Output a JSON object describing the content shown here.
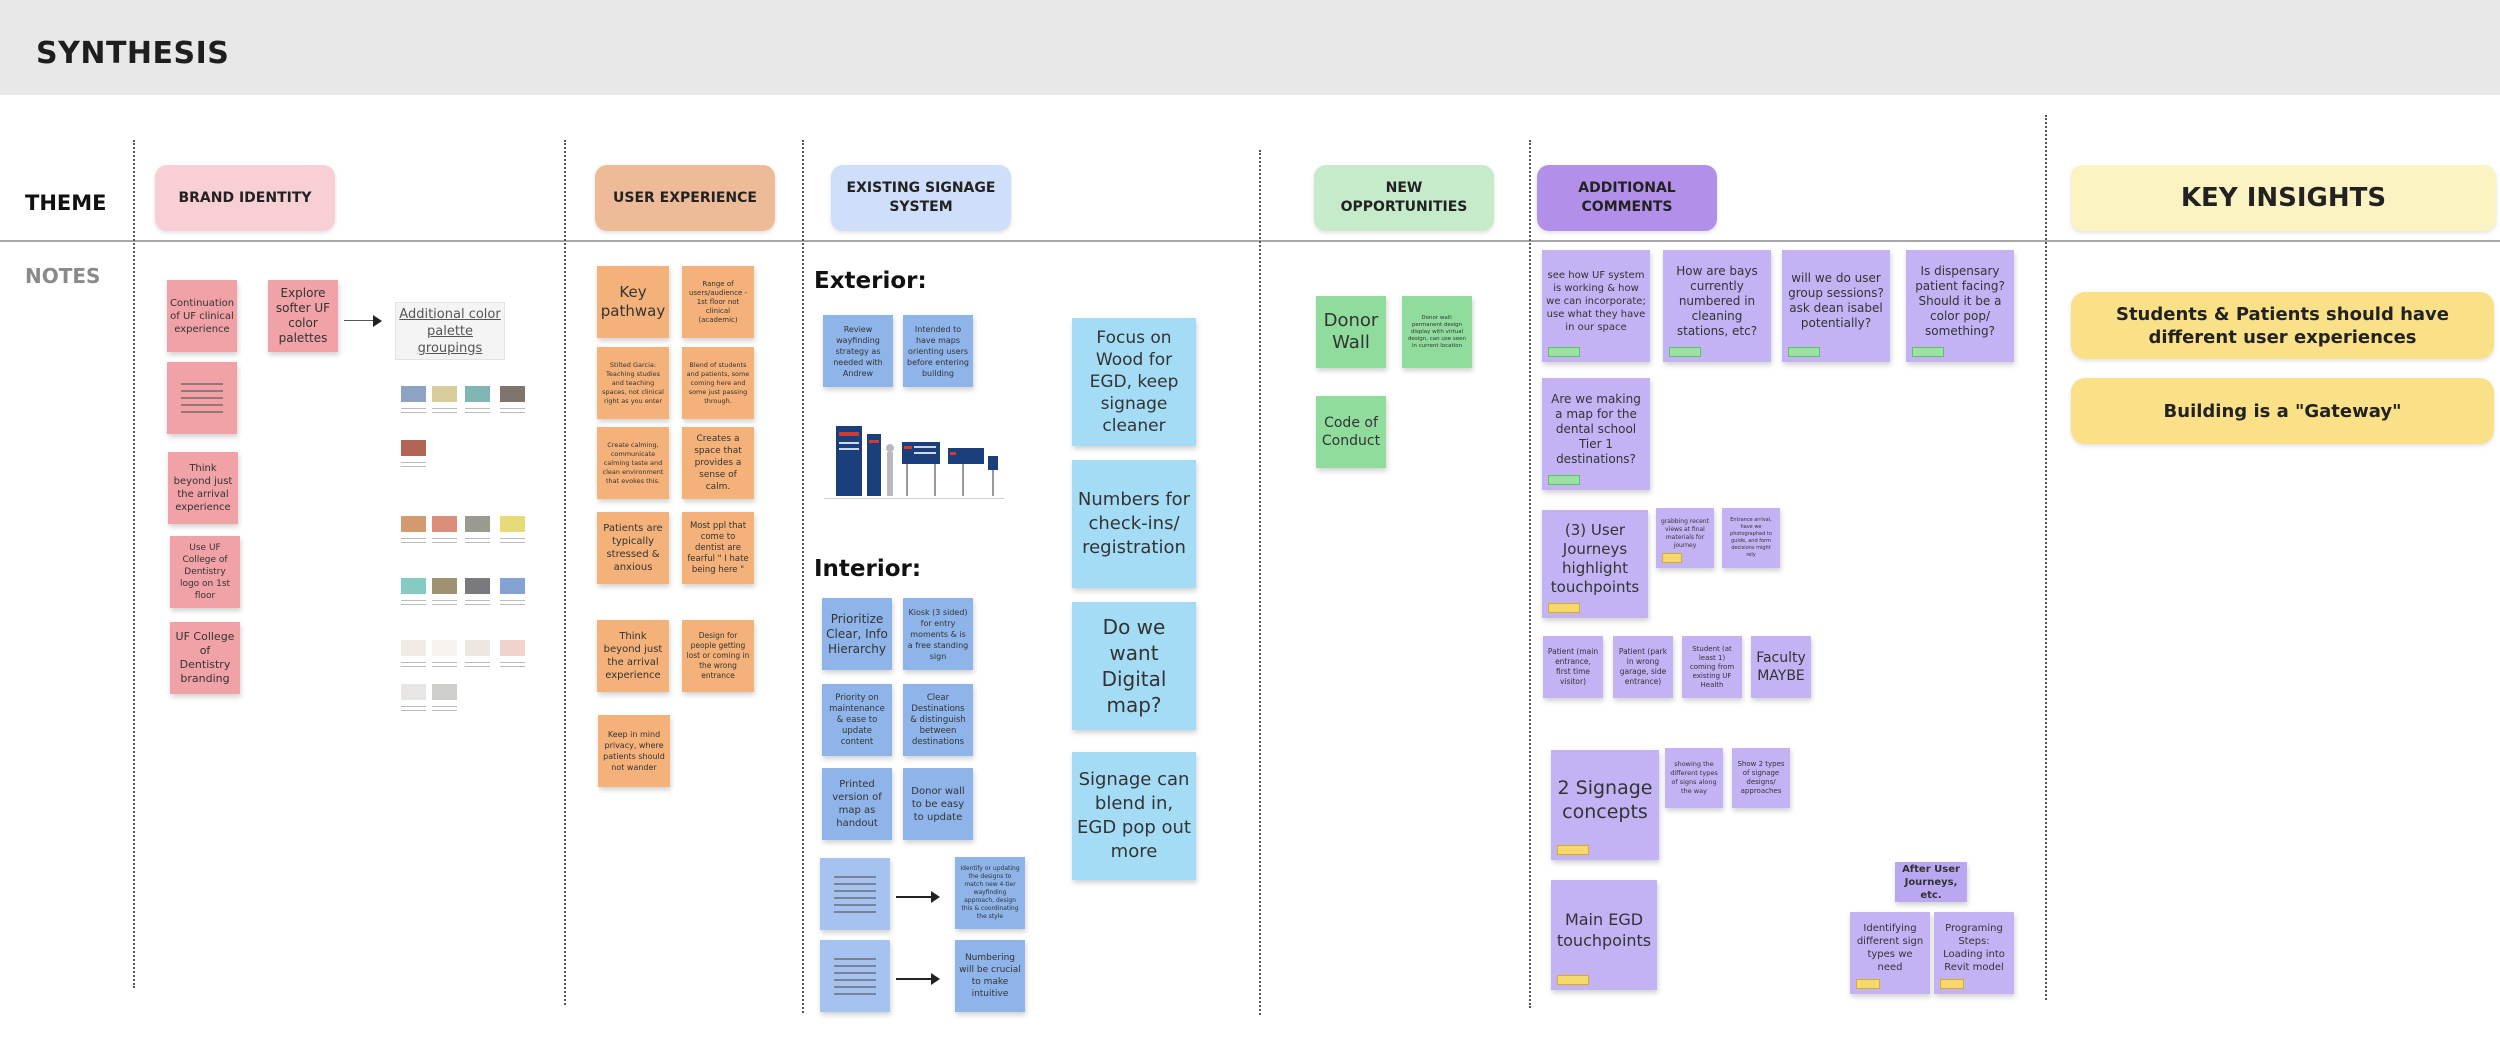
{
  "board": {
    "title": "SYNTHESIS"
  },
  "rows": {
    "theme": "THEME",
    "notes": "NOTES"
  },
  "colors": {
    "pink": "#f0a2a6",
    "orange": "#f4b27a",
    "blue": "#8eb4ea",
    "sky": "#a4dcf6",
    "green": "#8fdc9c",
    "purple": "#c3b3f4",
    "insight": "#fae187"
  },
  "themes": {
    "brand": "BRAND IDENTITY",
    "ux": "USER EXPERIENCE",
    "signage": "EXISTING SIGNAGE SYSTEM",
    "opportunities": "NEW OPPORTUNITIES",
    "comments": "ADDITIONAL COMMENTS",
    "insights": "KEY INSIGHTS"
  },
  "brand": {
    "n1": "Continuation of UF clinical experience",
    "n2": "Explore softer UF color palettes",
    "n3": "Think beyond just the arrival experience",
    "n4": "Use UF College of Dentistry logo on 1st floor",
    "n5": "UF College of Dentistry branding",
    "palette_link": "Additional color palette groupings"
  },
  "ux": {
    "n1": "Key pathway",
    "n2": "Range of users/audience - 1st floor not clinical (academic)",
    "n3": "Stilted Garcia: Teaching studies and teaching spaces, not clinical right as you enter",
    "n4": "Blend of students and patients, some coming here and some just passing through.",
    "n5": "Create calming, communicate calming taste and clean environment that evokes this.",
    "n6": "Creates a space that provides a sense of calm.",
    "n7": "Patients are typically stressed & anxious",
    "n8": "Most ppl that come to dentist are fearful \" I hate being here \"",
    "n9": "Think beyond just the arrival experience",
    "n10": "Design for people getting lost or coming in the wrong entrance",
    "n11": "Keep in mind privacy, where patients should not wander"
  },
  "signage": {
    "exterior": "Exterior:",
    "interior": "Interior:",
    "e1": "Review wayfinding strategy as needed with Andrew",
    "e2": "Intended to have maps orienting users before entering building",
    "i1": "Prioritize Clear, Info Hierarchy",
    "i2": "Kiosk (3 sided) for entry moments & is a free standing sign",
    "i3": "Priority on maintenance & ease to update content",
    "i4": "Clear Destinations & distinguish between destinations",
    "i5": "Printed version of map as handout",
    "i6": "Donor wall to be easy to update",
    "i7": "Identify or updating the designs to match new 4-tier wayfinding approach, design this & coordinating the style",
    "i8": "Numbering will be crucial to make intuitive",
    "s1": "Focus on Wood for EGD, keep signage cleaner",
    "s2": "Numbers for check-ins/ registration",
    "s3": "Do we want Digital map?",
    "s4": "Signage can blend in, EGD pop out more"
  },
  "opportunities": {
    "n1": "Donor Wall",
    "n2": "Donor wall: permanent design display with virtual design, can use seen in current location",
    "n3": "Code of Conduct"
  },
  "comments": {
    "c1": "see how UF system is working & how we can incorporate; use what they have in our space",
    "c2": "How are bays currently numbered in cleaning stations, etc?",
    "c3": "will we do user group sessions? ask dean isabel potentially?",
    "c4": "Is dispensary patient facing? Should it be a color pop/ something?",
    "c5": "Are we making a map for the dental school Tier 1 destinations?",
    "c6": "(3) User Journeys highlight touchpoints",
    "c7": "grabbing recent views at final materials for journey",
    "c8": "Entrance arrival, have we photographed to guide, and form decisions might rely",
    "c9": "Patient (main entrance, first time visitor)",
    "c10": "Patient (park in wrong garage, side entrance)",
    "c11": "Student (at least 1) coming from existing UF Health",
    "c12": "Faculty MAYBE",
    "c13": "2 Signage concepts",
    "c14": "showing the different types of signs along the way",
    "c15": "Show 2 types of signage designs/ approaches",
    "c16": "Main EGD touchpoints",
    "c17": "After User Journeys, etc.",
    "c18": "Identifying different sign types we need",
    "c19": "Programing Steps: Loading into Revit model"
  },
  "insights": {
    "i1": "Students & Patients should have different user experiences",
    "i2": "Building is a \"Gateway\""
  }
}
